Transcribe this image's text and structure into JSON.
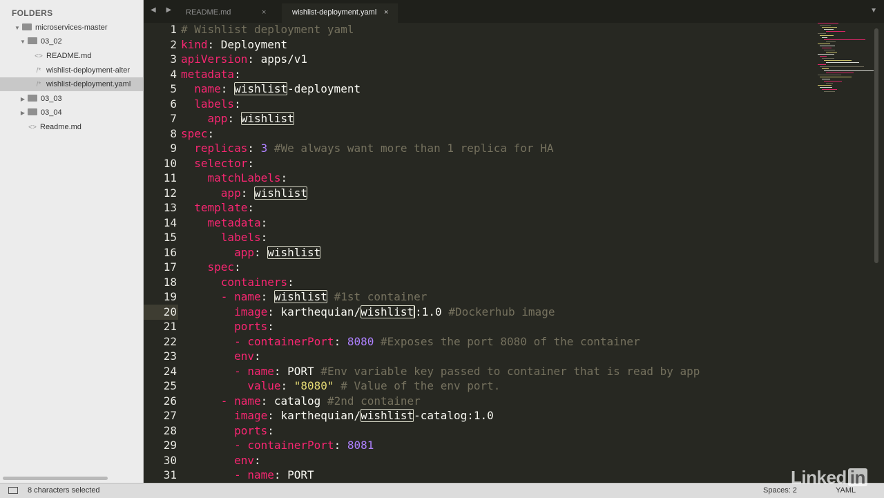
{
  "sidebar": {
    "title": "FOLDERS",
    "items": [
      {
        "label": "microservices-master",
        "type": "folder",
        "open": true
      },
      {
        "label": "03_02",
        "type": "folder",
        "open": true
      },
      {
        "label": "README.md",
        "type": "file",
        "icon": "<>"
      },
      {
        "label": "wishlist-deployment-alter",
        "type": "file",
        "icon": "/*"
      },
      {
        "label": "wishlist-deployment.yaml",
        "type": "file",
        "icon": "/*"
      },
      {
        "label": "03_03",
        "type": "folder",
        "open": false
      },
      {
        "label": "03_04",
        "type": "folder",
        "open": false
      },
      {
        "label": "Readme.md",
        "type": "file",
        "icon": "<>"
      }
    ]
  },
  "tabs": [
    {
      "label": "README.md",
      "close": "×"
    },
    {
      "label": "wishlist-deployment.yaml",
      "close": "×"
    }
  ],
  "nav_arrows": "◀ ▶",
  "tab_menu": "▼",
  "editor": {
    "current_line": 20,
    "line_numbers": [
      "1",
      "2",
      "3",
      "4",
      "5",
      "6",
      "7",
      "8",
      "9",
      "10",
      "11",
      "12",
      "13",
      "14",
      "15",
      "16",
      "17",
      "18",
      "19",
      "20",
      "21",
      "22",
      "23",
      "24",
      "25",
      "26",
      "27",
      "28",
      "29",
      "30",
      "31"
    ]
  },
  "status": {
    "selection": "8 characters selected",
    "spaces": "Spaces: 2",
    "syntax": "YAML"
  },
  "watermark": {
    "text": "Linked",
    "badge": "in"
  },
  "colors": {
    "keyword": "#f92672",
    "comment": "#75715e",
    "number": "#ae81ff",
    "string": "#e6db74",
    "background": "#272822"
  }
}
